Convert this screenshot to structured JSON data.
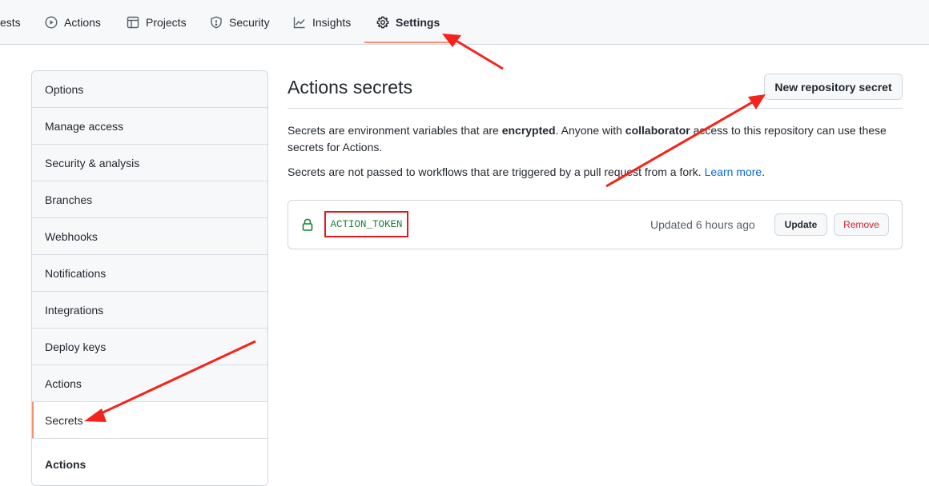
{
  "nav": {
    "tabs": [
      {
        "label": "ests",
        "icon": "none"
      },
      {
        "label": "Actions",
        "icon": "play-icon"
      },
      {
        "label": "Projects",
        "icon": "table-icon"
      },
      {
        "label": "Security",
        "icon": "shield-icon"
      },
      {
        "label": "Insights",
        "icon": "graph-icon"
      },
      {
        "label": "Settings",
        "icon": "gear-icon",
        "selected": true
      }
    ]
  },
  "sidebar": {
    "items": [
      {
        "label": "Options"
      },
      {
        "label": "Manage access"
      },
      {
        "label": "Security & analysis"
      },
      {
        "label": "Branches"
      },
      {
        "label": "Webhooks"
      },
      {
        "label": "Notifications"
      },
      {
        "label": "Integrations"
      },
      {
        "label": "Deploy keys"
      },
      {
        "label": "Actions"
      },
      {
        "label": "Secrets",
        "selected": true
      }
    ],
    "section_heading": "Actions"
  },
  "main": {
    "title": "Actions secrets",
    "new_secret_button": "New repository secret",
    "description": {
      "p1_a": "Secrets are environment variables that are ",
      "p1_b": "encrypted",
      "p1_c": ". Anyone with ",
      "p1_d": "collaborator",
      "p1_e": " access to this repository can use these secrets for Actions.",
      "p2_a": "Secrets are not passed to workflows that are triggered by a pull request from a fork. ",
      "p2_link": "Learn more",
      "p2_end": "."
    },
    "secret": {
      "name": "ACTION_TOKEN",
      "updated": "Updated 6 hours ago",
      "update_button": "Update",
      "remove_button": "Remove"
    }
  },
  "colors": {
    "accent_underline": "#fd8c73",
    "annotation_red": "#f5231b",
    "secret_green": "#1a7f37",
    "link_blue": "#0969da",
    "danger_red": "#cf222e"
  }
}
